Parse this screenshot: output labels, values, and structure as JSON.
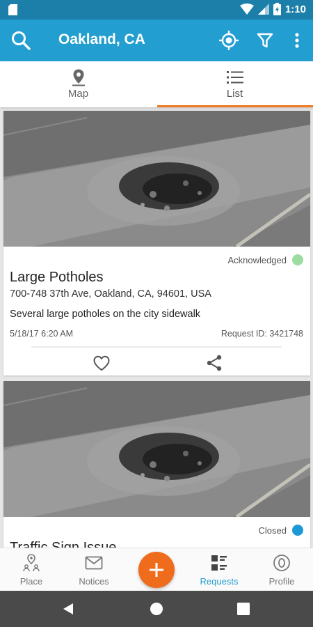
{
  "status_bar": {
    "time": "1:10"
  },
  "app_bar": {
    "title": "Oakland, CA"
  },
  "tabs": [
    {
      "label": "Map",
      "icon": "map-pin-icon"
    },
    {
      "label": "List",
      "icon": "list-icon"
    }
  ],
  "active_tab": "List",
  "reports": [
    {
      "title": "Large Potholes",
      "address": "700-748 37th Ave, Oakland, CA, 94601, USA",
      "description": "Several large potholes on the city sidewalk",
      "date": "5/18/17 6:20 AM",
      "request_id": "Request ID: 3421748",
      "status": "Acknowledged",
      "status_color": "#9bdc9f"
    },
    {
      "title": "Traffic Sign Issue",
      "status": "Closed",
      "status_color": "#1d9ad6"
    }
  ],
  "bottom_nav": [
    {
      "label": "Place",
      "icon": "place-icon"
    },
    {
      "label": "Notices",
      "icon": "mail-icon"
    },
    {
      "label": "Requests",
      "icon": "requests-icon"
    },
    {
      "label": "Profile",
      "icon": "profile-icon"
    }
  ],
  "active_nav": "Requests",
  "colors": {
    "status_bar": "#1c7fa9",
    "app_bar": "#239ed0",
    "tab_indicator": "#f07a22",
    "fab": "#ef6c1c",
    "active_nav": "#239ed0"
  }
}
